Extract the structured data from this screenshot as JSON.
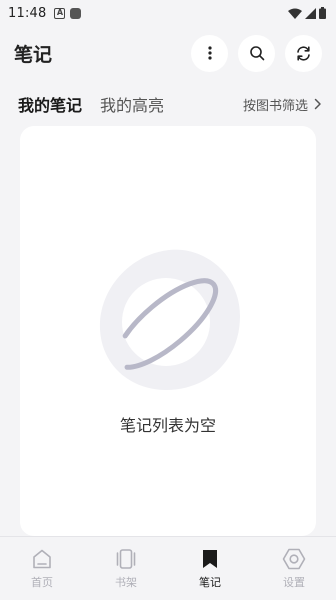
{
  "status_bar": {
    "time": "11:48",
    "icons": [
      "notification-a-icon",
      "notification-square-icon",
      "wifi-icon",
      "signal-icon",
      "battery-icon"
    ]
  },
  "header": {
    "title": "笔记",
    "actions": [
      "more-vertical-icon",
      "search-icon",
      "refresh-icon"
    ]
  },
  "tabs": [
    {
      "label": "我的笔记",
      "active": true
    },
    {
      "label": "我的高亮",
      "active": false
    }
  ],
  "filter": {
    "label": "按图书筛选"
  },
  "empty_state": {
    "text": "笔记列表为空"
  },
  "bottom_nav": [
    {
      "label": "首页",
      "icon": "home-icon",
      "active": false
    },
    {
      "label": "书架",
      "icon": "bookshelf-icon",
      "active": false
    },
    {
      "label": "笔记",
      "icon": "bookmark-icon",
      "active": true
    },
    {
      "label": "设置",
      "icon": "settings-icon",
      "active": false
    }
  ],
  "colors": {
    "background": "#f4f4f6",
    "card": "#ffffff",
    "text_primary": "#1a1a1a",
    "nav_inactive": "#b0b0b8",
    "planet_ring": "#b8b8c8"
  }
}
